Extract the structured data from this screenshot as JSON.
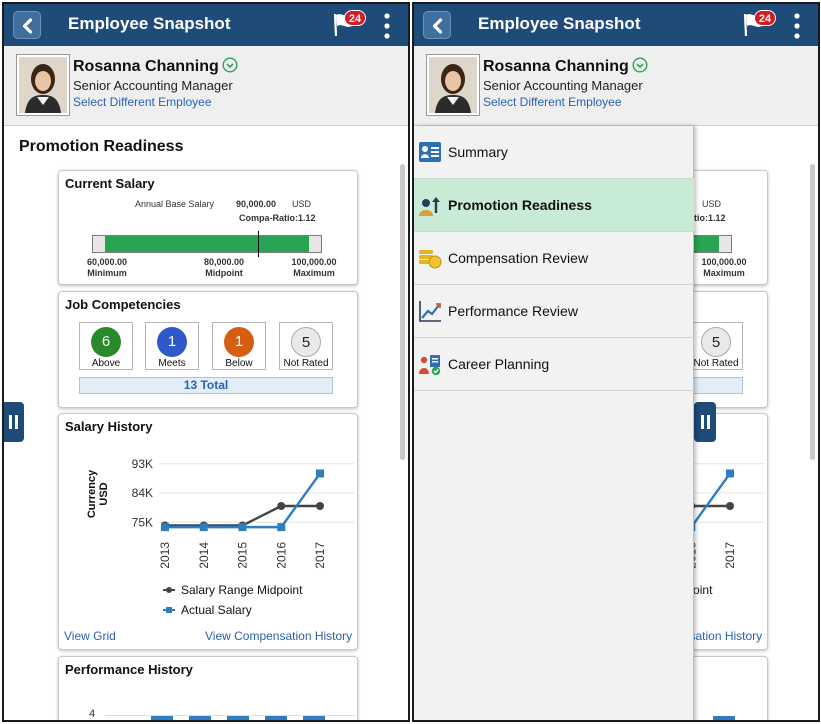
{
  "header": {
    "title": "Employee Snapshot",
    "notification_count": "24"
  },
  "employee": {
    "name": "Rosanna Channing",
    "title": "Senior Accounting Manager",
    "select_link": "Select Different Employee"
  },
  "page_title": "Promotion Readiness",
  "current_salary": {
    "title": "Current Salary",
    "annual_label": "Annual Base Salary",
    "annual_value": "90,000.00",
    "currency": "USD",
    "compa_ratio": "Compa-Ratio:1.12",
    "range": {
      "min": 60000,
      "mid": 80000,
      "max": 100000,
      "current": 90000
    },
    "min_value": "60,000.00",
    "min_label": "Minimum",
    "mid_value": "80,000.00",
    "mid_label": "Midpoint",
    "max_value": "100,000.00",
    "max_label": "Maximum"
  },
  "competencies": {
    "title": "Job Competencies",
    "items": [
      {
        "count": "6",
        "label": "Above",
        "color": "#2a8a2a"
      },
      {
        "count": "1",
        "label": "Meets",
        "color": "#2f58c9"
      },
      {
        "count": "1",
        "label": "Below",
        "color": "#d45f12"
      },
      {
        "count": "5",
        "label": "Not Rated",
        "color": "#e9e9e9"
      }
    ],
    "total": "13 Total"
  },
  "salary_history": {
    "title": "Salary History",
    "view_grid": "View Grid",
    "view_comp": "View Compensation History"
  },
  "performance_history": {
    "title": "Performance History"
  },
  "chart_data": {
    "type": "line",
    "title": "Salary History",
    "ylabel": "Currency USD",
    "ylabel_lines": [
      "Currency",
      "USD"
    ],
    "x": [
      "2013",
      "2014",
      "2015",
      "2016",
      "2017"
    ],
    "yticks": [
      "93K",
      "84K",
      "75K"
    ],
    "ytick_values": [
      93000,
      84000,
      75000
    ],
    "ylim": [
      72000,
      96000
    ],
    "series": [
      {
        "name": "Salary Range Midpoint",
        "values": [
          74000,
          74000,
          74000,
          80000,
          80000
        ],
        "color": "#444444"
      },
      {
        "name": "Actual Salary",
        "values": [
          73500,
          73500,
          73500,
          73500,
          90000
        ],
        "color": "#2e7dc1"
      }
    ],
    "legend": "bottom"
  },
  "nav": {
    "items": [
      {
        "label": "Summary",
        "icon": "summary-icon",
        "active": false
      },
      {
        "label": "Promotion Readiness",
        "icon": "promotion-icon",
        "active": true
      },
      {
        "label": "Compensation Review",
        "icon": "compensation-icon",
        "active": false
      },
      {
        "label": "Performance Review",
        "icon": "performance-icon",
        "active": false
      },
      {
        "label": "Career Planning",
        "icon": "career-icon",
        "active": false
      }
    ]
  },
  "colors": {
    "header": "#1f4b78",
    "link": "#2a62b4",
    "bar_fill": "#2aa355",
    "nav_active": "#c8ebd6"
  }
}
